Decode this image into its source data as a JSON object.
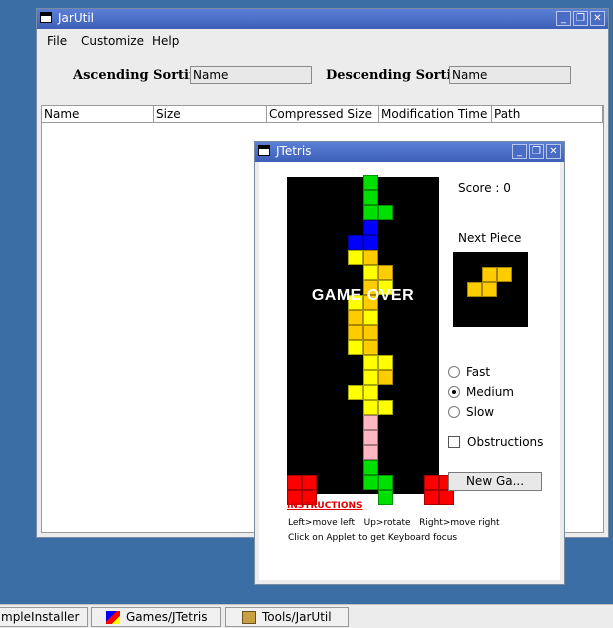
{
  "jarutil": {
    "title": "JarUtil",
    "menu": [
      "File",
      "Customize",
      "Help"
    ],
    "ascending_label": "Ascending Sorting",
    "ascending_value": "Name",
    "descending_label": "Descending Sorting",
    "descending_value": "Name",
    "columns": [
      "Name",
      "Size",
      "Compressed Size",
      "Modification Time",
      "Path"
    ]
  },
  "jtetris": {
    "title": "JTetris",
    "score_text": "Score : 0",
    "next_piece_label": "Next Piece",
    "game_over": "GAME OVER",
    "speed_options": [
      "Fast",
      "Medium",
      "Slow"
    ],
    "speed_selected": "Medium",
    "obstructions_label": "Obstructions",
    "obstructions_checked": false,
    "new_game_label": "New Ga...",
    "instructions_title": "INSTRUCTIONS",
    "instructions_line1": "Left>move left   Up>rotate   Right>move right",
    "instructions_line2": "Click on Applet to get Keyboard focus",
    "piece_colors": {
      "green": "#00e000",
      "yellow": "#ffff00",
      "gold": "#ffcc00",
      "blue": "#0000ff",
      "pink": "#ffb6c1",
      "red": "#ff0000"
    }
  },
  "taskbar": {
    "items": [
      "mpleInstaller",
      "Games/JTetris",
      "Tools/JarUtil"
    ]
  }
}
